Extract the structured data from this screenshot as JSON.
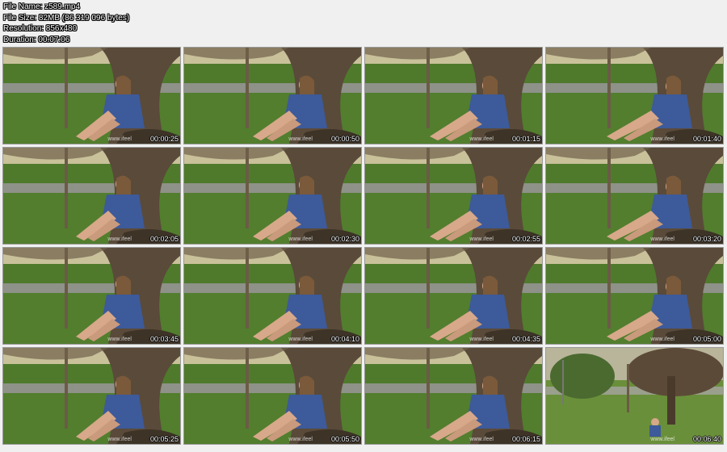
{
  "info": {
    "file_name": "File Name: z589.mp4",
    "file_size": "File Size: 82MB (86 319 096 bytes)",
    "resolution": "Resolution: 856x480",
    "duration": "Duration: 00:07:06"
  },
  "watermark": "www.ifeel",
  "thumbnails": [
    {
      "time": "00:00:25"
    },
    {
      "time": "00:00:50"
    },
    {
      "time": "00:01:15"
    },
    {
      "time": "00:01:40"
    },
    {
      "time": "00:02:05"
    },
    {
      "time": "00:02:30"
    },
    {
      "time": "00:02:55"
    },
    {
      "time": "00:03:20"
    },
    {
      "time": "00:03:45"
    },
    {
      "time": "00:04:10"
    },
    {
      "time": "00:04:35"
    },
    {
      "time": "00:05:00"
    },
    {
      "time": "00:05:25"
    },
    {
      "time": "00:05:50"
    },
    {
      "time": "00:06:15"
    },
    {
      "time": "00:06:40"
    }
  ],
  "colors": {
    "grass": "#4f7a2c",
    "sky": "#c9c19a",
    "path": "#8e9288",
    "trunk": "#5a4a3a",
    "dress": "#3d5a9a",
    "skin": "#d7a88a"
  }
}
